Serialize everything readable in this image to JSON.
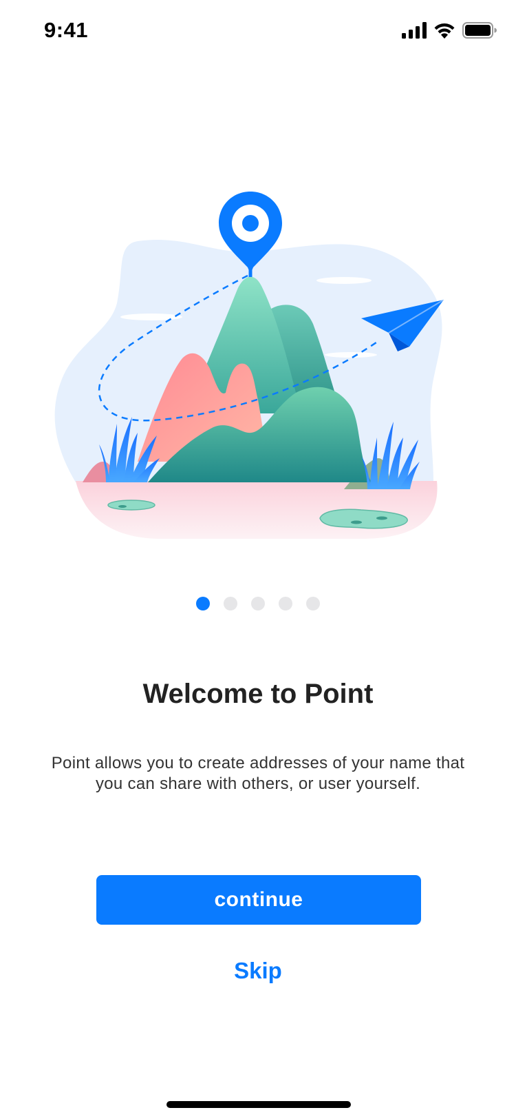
{
  "status_bar": {
    "time": "9:41",
    "signal_icon": "cellular-signal-icon",
    "wifi_icon": "wifi-icon",
    "battery_icon": "battery-icon"
  },
  "illustration": {
    "name": "mountain-location-paper-plane-illustration",
    "accent_color": "#0a7bff"
  },
  "pager": {
    "count": 5,
    "active_index": 0
  },
  "onboarding": {
    "title": "Welcome to Point",
    "description": "Point allows you to create addresses of your name that you can share with others, or user yourself."
  },
  "actions": {
    "continue_label": "continue",
    "skip_label": "Skip"
  },
  "colors": {
    "primary": "#0a7bff",
    "dot_inactive": "#e6e6e8",
    "text": "#222222"
  }
}
